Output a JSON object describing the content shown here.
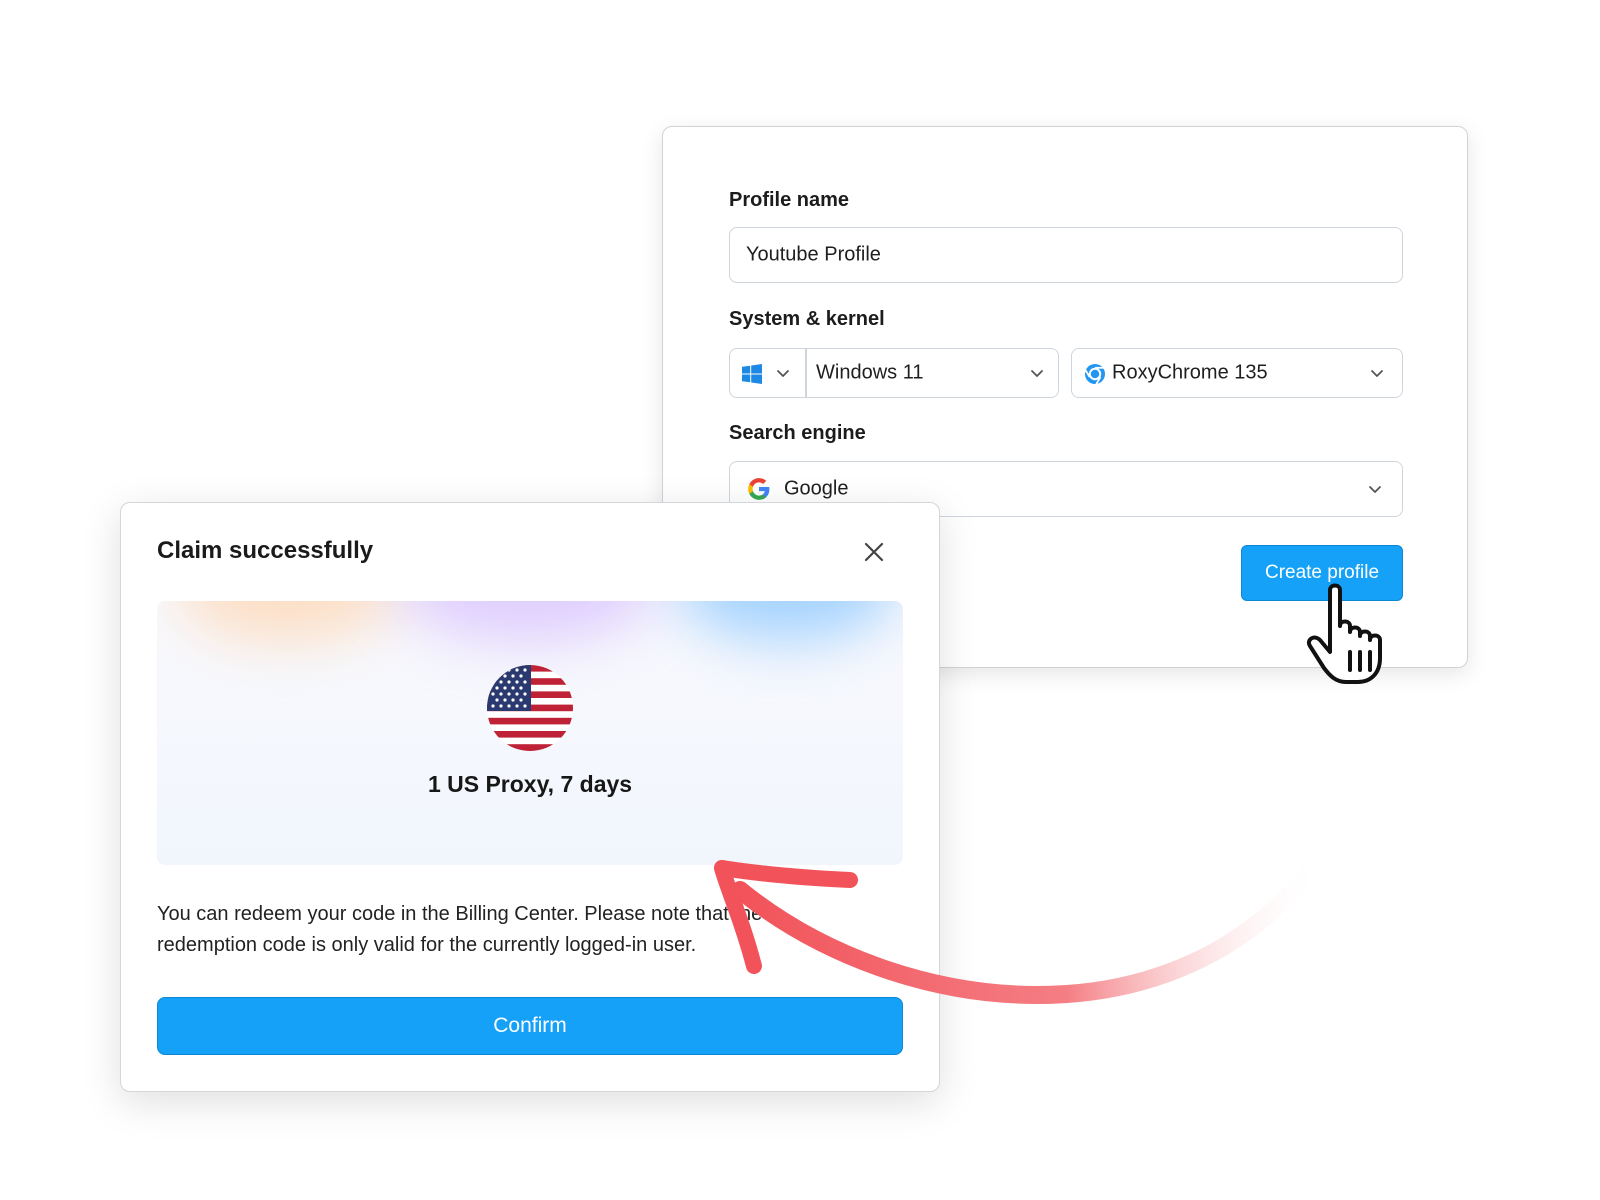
{
  "create_profile": {
    "profile_name_label": "Profile name",
    "profile_name_value": "Youtube Profile",
    "system_kernel_label": "System & kernel",
    "os_icon": "windows-icon",
    "os_value": "Windows 11",
    "kernel_icon": "roxychrome-icon",
    "kernel_value": "RoxyChrome 135",
    "search_engine_label": "Search engine",
    "search_engine_icon": "google-icon",
    "search_engine_value": "Google",
    "create_button_label": "Create profile"
  },
  "claim_dialog": {
    "title": "Claim successfully",
    "close_icon": "close-icon",
    "flag_icon": "us-flag-icon",
    "reward_text": "1 US Proxy, 7 days",
    "message": "You can redeem your code in the Billing Center. Please note that the redemption code is only valid for the currently logged-in user.",
    "confirm_label": "Confirm"
  },
  "colors": {
    "primary": "#14a1f7",
    "arrow": "#f2535a",
    "border": "#cfd5dc"
  }
}
